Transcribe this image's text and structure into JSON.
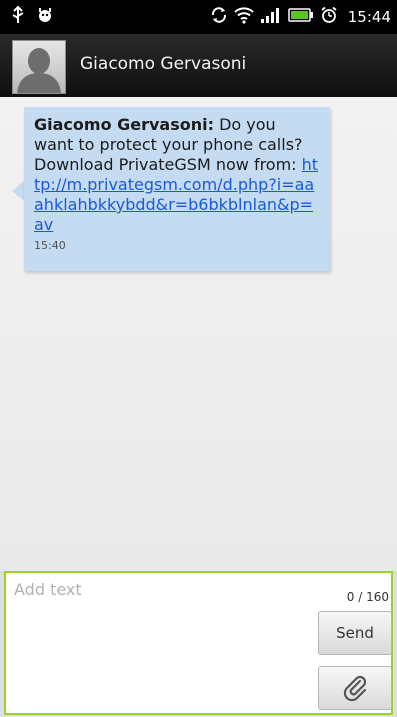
{
  "status_bar": {
    "time": "15:44",
    "icons": [
      "usb-icon",
      "android-debug-icon",
      "sync-icon",
      "wifi-icon",
      "signal-icon",
      "battery-icon",
      "alarm-icon"
    ]
  },
  "header": {
    "contact_name": "Giacomo Gervasoni",
    "avatar_icon": "person-silhouette-icon"
  },
  "conversation": {
    "messages": [
      {
        "sender": "Giacomo Gervasoni:",
        "text": " Do you want to protect your phone calls? Download PrivateGSM now from: ",
        "link": "http://m.privategsm.com/d.php?i=aaahklahbkkybdd&r=b6bkblnlan&p=av",
        "time": "15:40"
      }
    ]
  },
  "compose": {
    "placeholder": "Add text",
    "value": "",
    "counter": "0 / 160",
    "send_label": "Send",
    "attach_icon": "paperclip-icon"
  },
  "colors": {
    "bubble": "#c5dbf2",
    "link": "#1a5ad6",
    "input_border": "#9ad22c",
    "battery": "#5ec424"
  }
}
